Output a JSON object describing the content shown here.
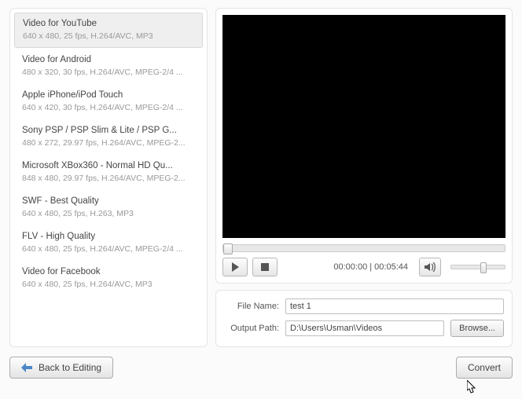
{
  "presets": [
    {
      "title": "Video for YouTube",
      "desc": "640 x 480, 25 fps, H.264/AVC, MP3",
      "selected": true
    },
    {
      "title": "Video for Android",
      "desc": "480 x 320, 30 fps, H.264/AVC, MPEG-2/4 ..."
    },
    {
      "title": "Apple iPhone/iPod Touch",
      "desc": "640 x 420, 30 fps, H.264/AVC, MPEG-2/4 ..."
    },
    {
      "title": "Sony PSP / PSP Slim & Lite / PSP G...",
      "desc": "480 x 272, 29.97 fps, H.264/AVC, MPEG-2..."
    },
    {
      "title": "Microsoft XBox360 - Normal HD Qu...",
      "desc": "848 x 480, 29.97 fps, H.264/AVC, MPEG-2..."
    },
    {
      "title": "SWF - Best Quality",
      "desc": "640 x 480, 25 fps, H.263, MP3"
    },
    {
      "title": "FLV - High Quality",
      "desc": "640 x 480, 25 fps, H.264/AVC, MPEG-2/4 ..."
    },
    {
      "title": "Video for Facebook",
      "desc": "640 x 480, 25 fps, H.264/AVC, MP3"
    }
  ],
  "player": {
    "timecode": "00:00:00 | 00:05:44"
  },
  "output": {
    "filename_label": "File Name:",
    "filename_value": "test 1",
    "path_label": "Output Path:",
    "path_value": "D:\\Users\\Usman\\Videos",
    "browse_label": "Browse..."
  },
  "footer": {
    "back_label": "Back to Editing",
    "convert_label": "Convert"
  }
}
